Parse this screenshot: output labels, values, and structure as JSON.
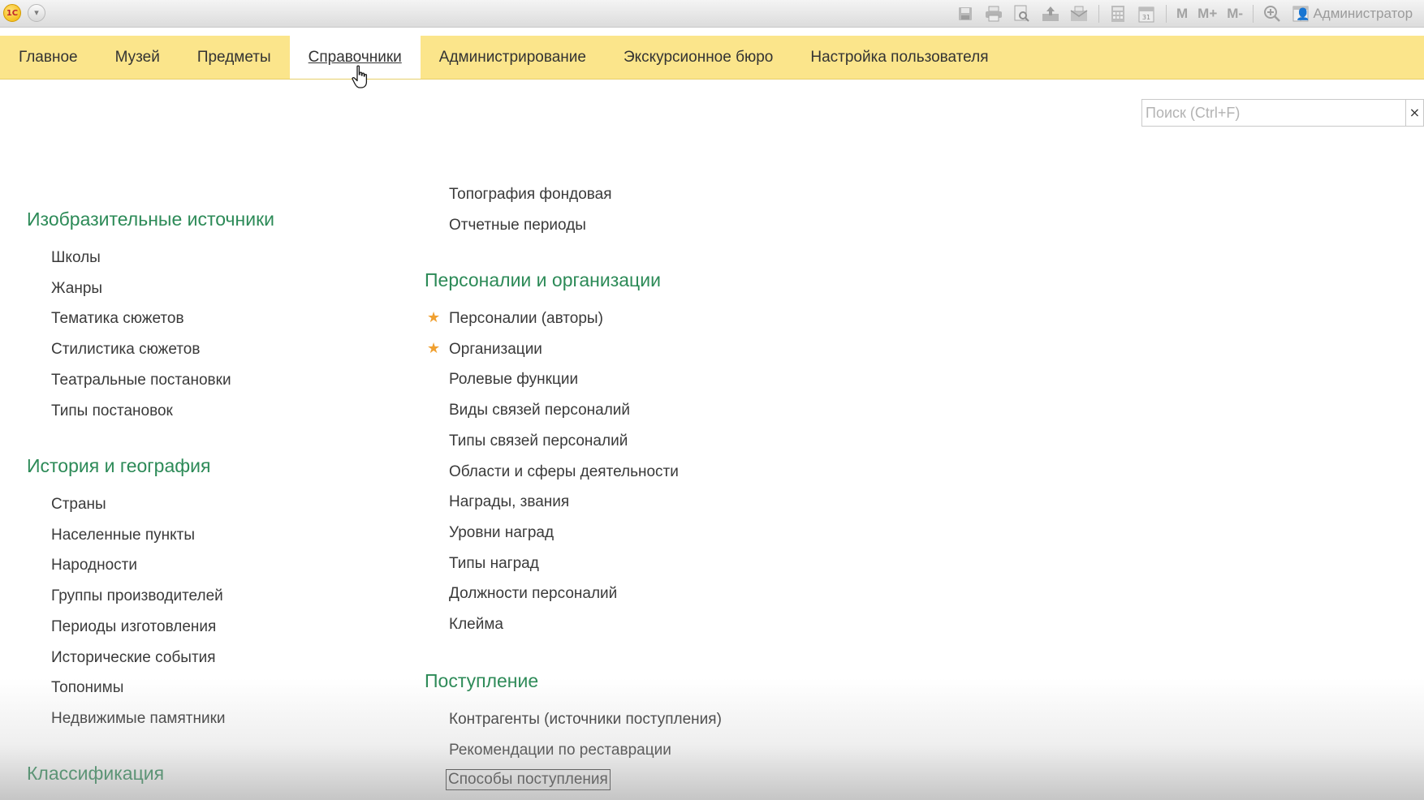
{
  "app": {
    "logo_text": "1С",
    "user_name": "Администратор"
  },
  "toolbar": {
    "icons": [
      "save-icon",
      "print-icon",
      "preview-icon",
      "upload-icon",
      "mail-icon",
      "calculator-icon",
      "calendar-icon"
    ],
    "memory": [
      "M",
      "M+",
      "M-"
    ],
    "icons_right": [
      "zoom-icon",
      "window-icon"
    ]
  },
  "sections": [
    {
      "label": "Главное"
    },
    {
      "label": "Музей"
    },
    {
      "label": "Предметы"
    },
    {
      "label": "Справочники",
      "active": true
    },
    {
      "label": "Администрирование"
    },
    {
      "label": "Экскурсионное бюро"
    },
    {
      "label": "Настройка пользователя"
    }
  ],
  "search": {
    "placeholder": "Поиск (Ctrl+F)",
    "value": "",
    "clear": "×"
  },
  "left_column": {
    "groups": [
      {
        "title": "Изобразительные источники",
        "items": [
          "Школы",
          "Жанры",
          "Тематика сюжетов",
          "Стилистика сюжетов",
          "Театральные постановки",
          "Типы постановок"
        ]
      },
      {
        "title": "История и география",
        "items": [
          "Страны",
          "Населенные пункты",
          "Народности",
          "Группы производителей",
          "Периоды изготовления",
          "Исторические события",
          "Топонимы",
          "Недвижимые памятники"
        ]
      },
      {
        "title": "Классификация",
        "items": []
      }
    ]
  },
  "right_column": {
    "top_items": [
      "Топография фондовая",
      "Отчетные периоды"
    ],
    "groups": [
      {
        "title": "Персоналии и организации",
        "items": [
          {
            "label": "Персоналии (авторы)",
            "starred": true
          },
          {
            "label": "Организации",
            "starred": true
          },
          {
            "label": "Ролевые функции"
          },
          {
            "label": "Виды связей персоналий"
          },
          {
            "label": "Типы связей персоналий"
          },
          {
            "label": "Области и сферы деятельности"
          },
          {
            "label": "Награды, звания"
          },
          {
            "label": "Уровни наград"
          },
          {
            "label": "Типы наград"
          },
          {
            "label": "Должности персоналий"
          },
          {
            "label": "Клейма"
          }
        ]
      },
      {
        "title": "Поступление",
        "items": [
          {
            "label": "Контрагенты (источники поступления)"
          },
          {
            "label": "Рекомендации по реставрации"
          },
          {
            "label": "Способы поступления",
            "focused": true
          }
        ]
      }
    ]
  },
  "colors": {
    "section_bar": "#fbe58b",
    "group_title": "#2c8a57",
    "star": "#f0a030"
  }
}
